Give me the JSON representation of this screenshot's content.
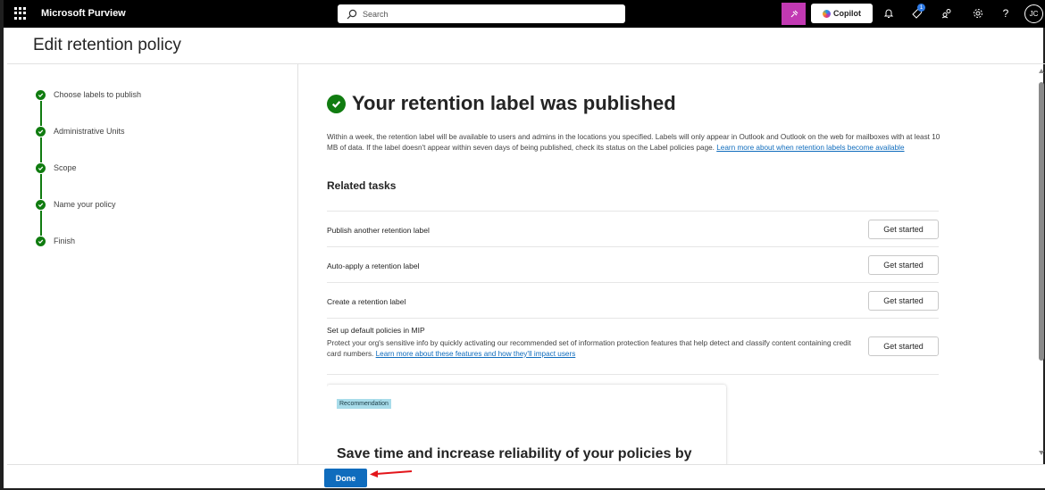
{
  "topbar": {
    "app_name": "Microsoft Purview",
    "search_placeholder": "Search",
    "copilot_label": "Copilot",
    "notification_badge": "1",
    "user_initials": "JC"
  },
  "page": {
    "title": "Edit retention policy"
  },
  "steps": [
    {
      "label": "Choose labels to publish",
      "status": "complete"
    },
    {
      "label": "Administrative Units",
      "status": "complete"
    },
    {
      "label": "Scope",
      "status": "complete"
    },
    {
      "label": "Name your policy",
      "status": "complete"
    },
    {
      "label": "Finish",
      "status": "complete"
    }
  ],
  "main": {
    "success_title": "Your retention label was published",
    "description": "Within a week, the retention label will be available to users and admins in the locations you specified. Labels will only appear in Outlook and Outlook on the web for mailboxes with at least 10 MB of data. If the label doesn't appear within seven days of being published, check its status on the Label policies page.",
    "description_link": "Learn more about when retention labels become available",
    "related_tasks_heading": "Related tasks",
    "tasks": [
      {
        "name": "Publish another retention label",
        "button": "Get started"
      },
      {
        "name": "Auto-apply a retention label",
        "button": "Get started"
      },
      {
        "name": "Create a retention label",
        "button": "Get started"
      },
      {
        "name": "Set up default policies in MIP",
        "button": "Get started",
        "description": "Protect your org's sensitive info by quickly activating our recommended set of information protection features that help detect and classify content containing credit card numbers.",
        "link": "Learn more about these features and how they'll impact users"
      }
    ],
    "recommendation": {
      "tag": "Recommendation",
      "title": "Save time and increase reliability of your policies by"
    }
  },
  "footer": {
    "done_label": "Done"
  },
  "colors": {
    "success_green": "#107c10",
    "primary_blue": "#0f6cbd",
    "copilot_pink": "#c239b3",
    "annotation_arrow": "#e3151a"
  }
}
